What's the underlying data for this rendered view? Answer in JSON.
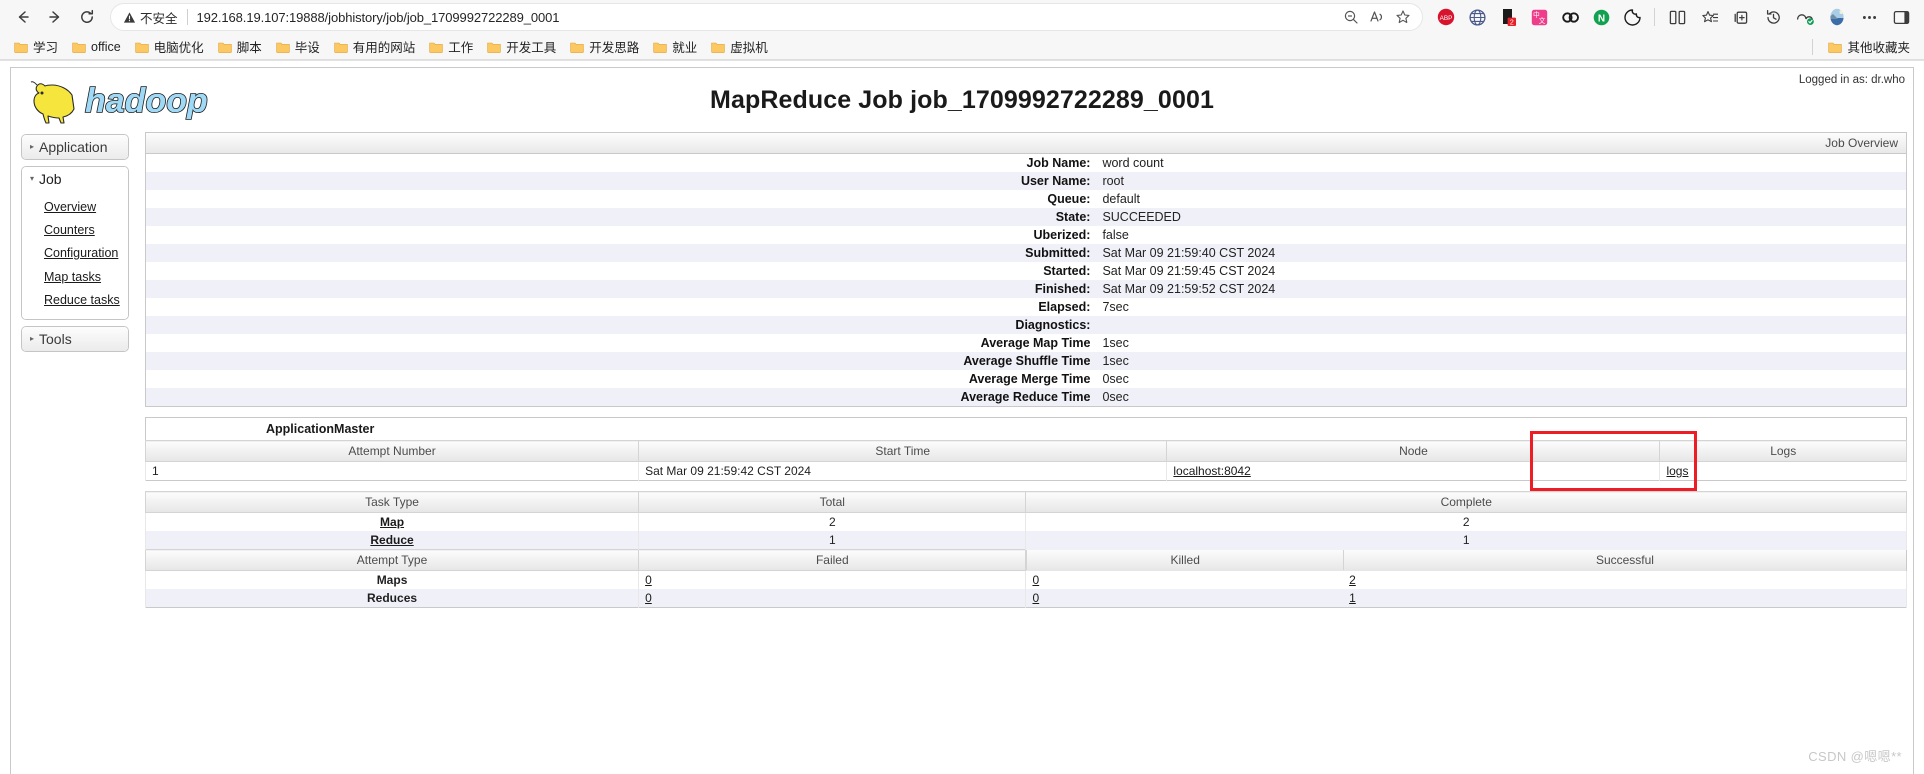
{
  "browser": {
    "nav": {
      "back": "back-arrow",
      "forward": "forward-arrow",
      "reload": "reload"
    },
    "security_label": "不安全",
    "url": "192.168.19.107:19888/jobhistory/job/job_1709992722289_0001",
    "omnibox_actions": [
      "zoom-out-icon",
      "read-aloud-icon",
      "favorite-icon"
    ],
    "extensions": [
      "abp-icon",
      "globe-icon",
      "download-badge-icon",
      "translate-icon",
      "co-icon",
      "notion-icon",
      "cookie-icon"
    ],
    "window_actions": [
      "split-screen-icon",
      "collections-icon",
      "add-collection-icon",
      "history-icon",
      "performance-icon",
      "profile-avatar-icon",
      "more-icon",
      "sidebar-icon"
    ],
    "download_badge": "2",
    "bookmarks": [
      "学习",
      "office",
      "电脑优化",
      "脚本",
      "毕设",
      "有用的网站",
      "工作",
      "开发工具",
      "开发思路",
      "就业",
      "虚拟机"
    ],
    "other_bookmarks": "其他收藏夹"
  },
  "page": {
    "logged_in": "Logged in as: dr.who",
    "title": "MapReduce Job job_1709992722289_0001",
    "logo_alt": "hadoop",
    "watermark": "CSDN @嗯嗯**"
  },
  "sidebar": {
    "groups": [
      {
        "label": "Application",
        "expanded": false,
        "items": []
      },
      {
        "label": "Job",
        "expanded": true,
        "items": [
          "Overview",
          "Counters",
          "Configuration",
          "Map tasks",
          "Reduce tasks"
        ]
      },
      {
        "label": "Tools",
        "expanded": false,
        "items": []
      }
    ]
  },
  "job_overview": {
    "caption": "Job Overview",
    "rows": [
      {
        "label": "Job Name:",
        "value": "word count"
      },
      {
        "label": "User Name:",
        "value": "root"
      },
      {
        "label": "Queue:",
        "value": "default"
      },
      {
        "label": "State:",
        "value": "SUCCEEDED"
      },
      {
        "label": "Uberized:",
        "value": "false"
      },
      {
        "label": "Submitted:",
        "value": "Sat Mar 09 21:59:40 CST 2024"
      },
      {
        "label": "Started:",
        "value": "Sat Mar 09 21:59:45 CST 2024"
      },
      {
        "label": "Finished:",
        "value": "Sat Mar 09 21:59:52 CST 2024"
      },
      {
        "label": "Elapsed:",
        "value": "7sec"
      },
      {
        "label": "Diagnostics:",
        "value": ""
      },
      {
        "label": "Average Map Time",
        "value": "1sec"
      },
      {
        "label": "Average Shuffle Time",
        "value": "1sec"
      },
      {
        "label": "Average Merge Time",
        "value": "0sec"
      },
      {
        "label": "Average Reduce Time",
        "value": "0sec"
      }
    ]
  },
  "application_master": {
    "title": "ApplicationMaster",
    "headers": [
      "Attempt Number",
      "Start Time",
      "Node",
      "Logs"
    ],
    "row": {
      "attempt_number": "1",
      "start_time": "Sat Mar 09 21:59:42 CST 2024",
      "node": "localhost:8042",
      "logs": "logs"
    }
  },
  "task_summary": {
    "headers": [
      "Task Type",
      "Total",
      "Complete"
    ],
    "rows": [
      {
        "type": "Map",
        "total": "2",
        "complete": "2"
      },
      {
        "type": "Reduce",
        "total": "1",
        "complete": "1"
      }
    ]
  },
  "attempt_summary": {
    "headers": [
      "Attempt Type",
      "Failed",
      "Killed",
      "Successful"
    ],
    "rows": [
      {
        "type": "Maps",
        "failed": "0",
        "killed": "0",
        "successful": "2"
      },
      {
        "type": "Reduces",
        "failed": "0",
        "killed": "0",
        "successful": "1"
      }
    ]
  },
  "annotation": {
    "highlight_color": "#ee1c25",
    "highlights": "logs-column"
  }
}
